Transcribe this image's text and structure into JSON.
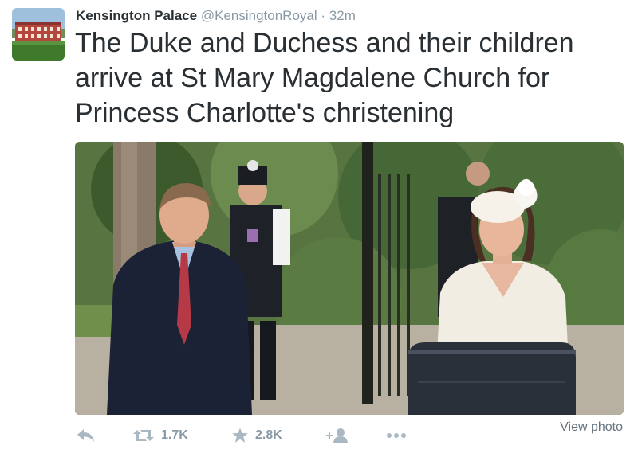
{
  "tweet": {
    "author_name": "Kensington Palace",
    "handle": "@KensingtonRoyal",
    "separator": "·",
    "time": "32m",
    "text": "The Duke and Duchess and their children arrive at St Mary Magdalene Church for Princess Charlotte's christening"
  },
  "actions": {
    "retweet_count": "1.7K",
    "favorite_count": "2.8K",
    "view_photo_label": "View photo"
  },
  "icons": {
    "reply": "reply-icon",
    "retweet": "retweet-icon",
    "favorite": "star-icon",
    "follow": "follow-icon",
    "more": "more-icon"
  },
  "colors": {
    "name": "#292f33",
    "meta": "#8899a6",
    "action_icon": "#aab8c2",
    "view_photo": "#66757f"
  }
}
